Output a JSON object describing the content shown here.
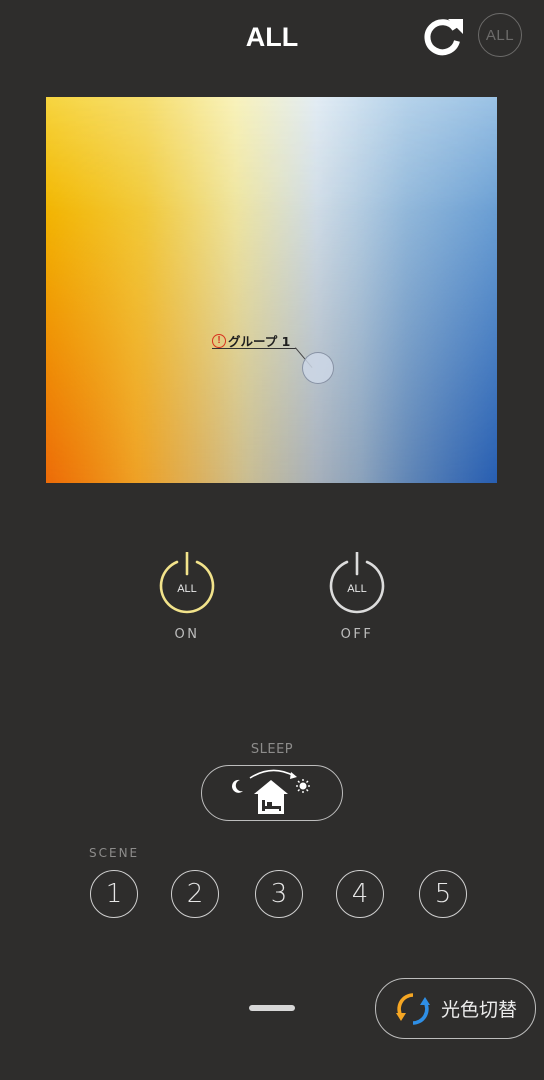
{
  "header": {
    "title": "ALL",
    "all_toggle_label": "ALL"
  },
  "color_pad": {
    "group_label": "グループ 1",
    "warning_mark": "!"
  },
  "power": {
    "on": {
      "inner_label": "ALL",
      "caption": "ON",
      "ring_color": "#f2e38b"
    },
    "off": {
      "inner_label": "ALL",
      "caption": "OFF",
      "ring_color": "#dcdcdc"
    }
  },
  "sleep": {
    "label": "SLEEP"
  },
  "scene": {
    "label": "SCENE",
    "buttons": [
      "1",
      "2",
      "3",
      "4",
      "5"
    ]
  },
  "footer": {
    "switch_label": "光色切替",
    "switch_icon_colors": [
      "#f5a623",
      "#2f8fe6"
    ]
  },
  "icons": {
    "refresh": "refresh-icon",
    "moon": "moon-icon",
    "house_bed": "house-bed-icon",
    "sun": "sun-icon",
    "color_switch": "color-switch-icon"
  },
  "colors": {
    "background": "#2e2d2c",
    "accent_on": "#f2e38b",
    "warning": "#d8331f"
  }
}
